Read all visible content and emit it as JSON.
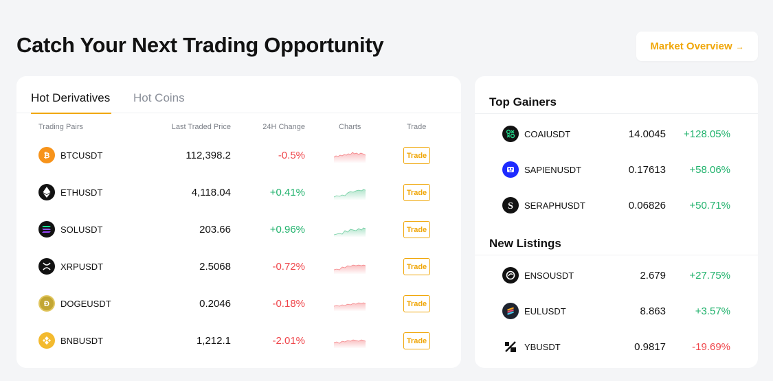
{
  "page": {
    "title": "Catch Your Next Trading Opportunity",
    "overview_button": "Market Overview",
    "overview_arrow": "→"
  },
  "colors": {
    "accent": "#f0a70a",
    "up": "#20b26c",
    "down": "#ef454a"
  },
  "tabs": [
    {
      "label": "Hot Derivatives",
      "active": true
    },
    {
      "label": "Hot Coins",
      "active": false
    }
  ],
  "table": {
    "headers": {
      "pair": "Trading Pairs",
      "price": "Last Traded Price",
      "change": "24H Change",
      "charts": "Charts",
      "trade": "Trade"
    },
    "rows": [
      {
        "pair": "BTCUSDT",
        "price": "112,398.2",
        "change": "-0.5%",
        "direction": "down",
        "icon": "bitcoin-icon",
        "trade": "Trade"
      },
      {
        "pair": "ETHUSDT",
        "price": "4,118.04",
        "change": "+0.41%",
        "direction": "up",
        "icon": "ethereum-icon",
        "trade": "Trade"
      },
      {
        "pair": "SOLUSDT",
        "price": "203.66",
        "change": "+0.96%",
        "direction": "up",
        "icon": "solana-icon",
        "trade": "Trade"
      },
      {
        "pair": "XRPUSDT",
        "price": "2.5068",
        "change": "-0.72%",
        "direction": "down",
        "icon": "xrp-icon",
        "trade": "Trade"
      },
      {
        "pair": "DOGEUSDT",
        "price": "0.2046",
        "change": "-0.18%",
        "direction": "down",
        "icon": "dogecoin-icon",
        "trade": "Trade"
      },
      {
        "pair": "BNBUSDT",
        "price": "1,212.1",
        "change": "-2.01%",
        "direction": "down",
        "icon": "bnb-icon",
        "trade": "Trade"
      }
    ]
  },
  "top_gainers": {
    "title": "Top Gainers",
    "rows": [
      {
        "pair": "COAIUSDT",
        "price": "14.0045",
        "change": "+128.05%",
        "direction": "up",
        "icon": "coai-icon"
      },
      {
        "pair": "SAPIENUSDT",
        "price": "0.17613",
        "change": "+58.06%",
        "direction": "up",
        "icon": "sapien-icon"
      },
      {
        "pair": "SERAPHUSDT",
        "price": "0.06826",
        "change": "+50.71%",
        "direction": "up",
        "icon": "seraph-icon"
      }
    ]
  },
  "new_listings": {
    "title": "New Listings",
    "rows": [
      {
        "pair": "ENSOUSDT",
        "price": "2.679",
        "change": "+27.75%",
        "direction": "up",
        "icon": "enso-icon"
      },
      {
        "pair": "EULUSDT",
        "price": "8.863",
        "change": "+3.57%",
        "direction": "up",
        "icon": "eul-icon"
      },
      {
        "pair": "YBUSDT",
        "price": "0.9817",
        "change": "-19.69%",
        "direction": "down",
        "icon": "yb-icon"
      }
    ]
  }
}
